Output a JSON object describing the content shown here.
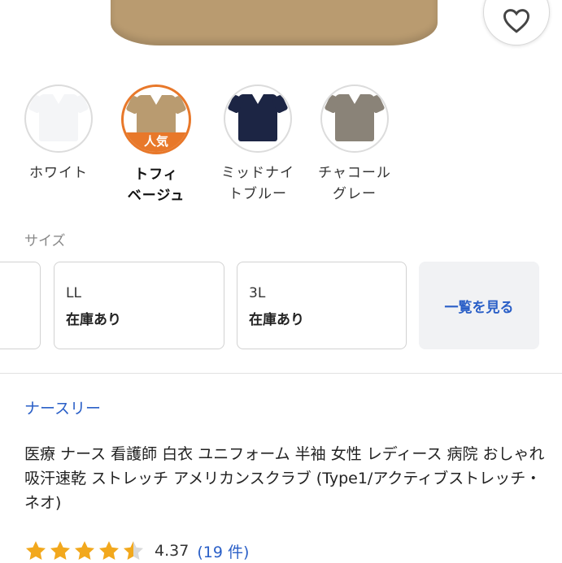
{
  "colors": {
    "accent_orange": "#e8782a",
    "link_blue": "#2a5fc7",
    "star_yellow": "#f2a81d"
  },
  "color_options": [
    {
      "label": "ホワイト",
      "shirt_color": "#f4f5f7",
      "selected": false
    },
    {
      "label": "トフィ\nベージュ",
      "shirt_color": "#b99b70",
      "selected": true,
      "badge": "人気"
    },
    {
      "label": "ミッドナイ\nトブルー",
      "shirt_color": "#1c2544",
      "selected": false
    },
    {
      "label": "チャコール\nグレー",
      "shirt_color": "#8a8378",
      "selected": false
    }
  ],
  "sizes": {
    "heading": "サイズ",
    "options": [
      {
        "name": "LL",
        "stock": "在庫あり"
      },
      {
        "name": "3L",
        "stock": "在庫あり"
      }
    ],
    "view_all": "一覧を見る"
  },
  "product": {
    "brand": "ナースリー",
    "title": "医療 ナース 看護師 白衣 ユニフォーム 半袖 女性 レディース 病院 おしゃれ 吸汗速乾 ストレッチ アメリカンスクラブ (Type1/アクティブストレッチ・ネオ)",
    "rating": 4.37,
    "rating_text": "4.37",
    "review_count": "(19 件)"
  },
  "icons": {
    "favorite": "heart-icon",
    "star": "star-icon"
  }
}
